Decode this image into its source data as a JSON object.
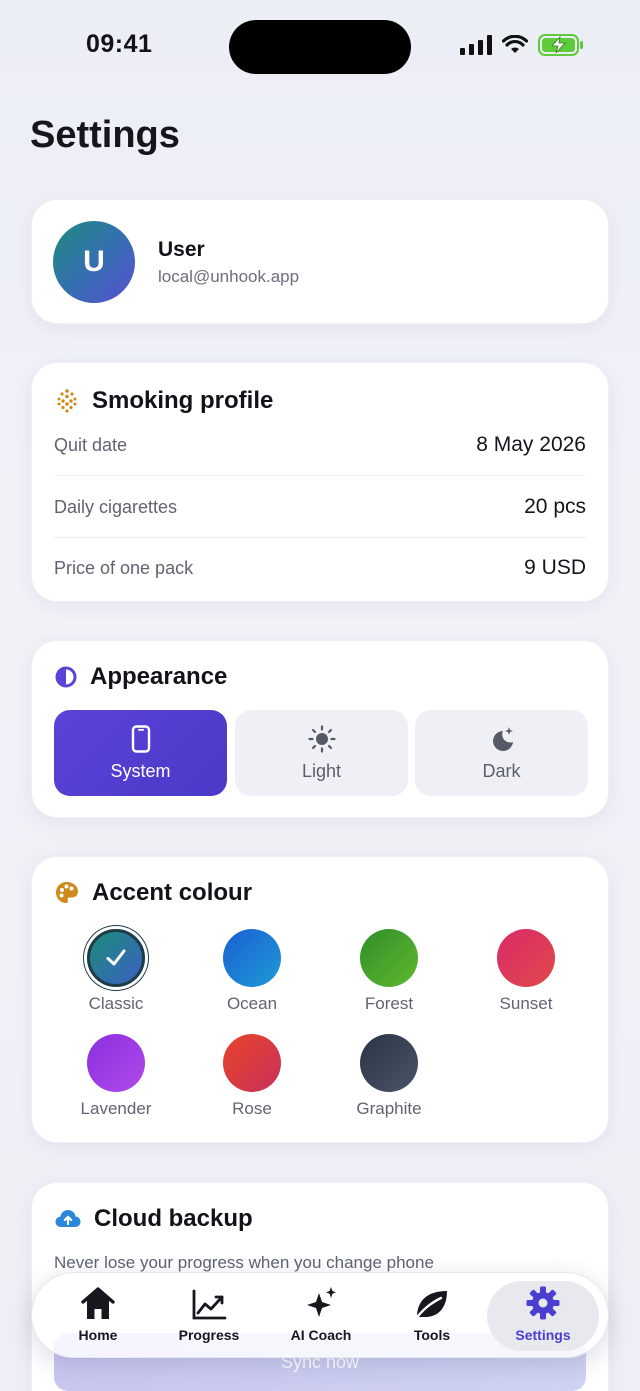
{
  "status_bar": {
    "time": "09:41"
  },
  "page": {
    "title": "Settings"
  },
  "profile": {
    "initial": "U",
    "name": "User",
    "email": "local@unhook.app"
  },
  "smoking_profile": {
    "title": "Smoking profile",
    "rows": [
      {
        "label": "Quit date",
        "value": "8 May 2026"
      },
      {
        "label": "Daily cigarettes",
        "value": "20 pcs"
      },
      {
        "label": "Price of one pack",
        "value": "9 USD"
      }
    ]
  },
  "appearance": {
    "title": "Appearance",
    "options": [
      {
        "label": "System",
        "icon": "phone-icon",
        "selected": true
      },
      {
        "label": "Light",
        "icon": "sun-icon",
        "selected": false
      },
      {
        "label": "Dark",
        "icon": "moon-icon",
        "selected": false
      }
    ]
  },
  "accent": {
    "title": "Accent colour",
    "selected": "Classic",
    "swatches": [
      {
        "name": "Classic",
        "color_from": "#1c8c78",
        "color_to": "#3b5fc4"
      },
      {
        "name": "Ocean",
        "color_from": "#1a5fd0",
        "color_to": "#1e9ad8"
      },
      {
        "name": "Forest",
        "color_from": "#2f8f2a",
        "color_to": "#5fb82e"
      },
      {
        "name": "Sunset",
        "color_from": "#d92a6a",
        "color_to": "#e04a4a"
      },
      {
        "name": "Lavender",
        "color_from": "#8a2fe0",
        "color_to": "#b04ae8"
      },
      {
        "name": "Rose",
        "color_from": "#e8442a",
        "color_to": "#c8305a"
      },
      {
        "name": "Graphite",
        "color_from": "#2c3446",
        "color_to": "#4a5468"
      }
    ]
  },
  "cloud_backup": {
    "title": "Cloud backup",
    "description": "Never lose your progress when you change phone",
    "sync_label": "Sync now"
  },
  "tabbar": {
    "tabs": [
      {
        "label": "Home",
        "icon": "home-icon",
        "active": false
      },
      {
        "label": "Progress",
        "icon": "chart-trend-icon",
        "active": false
      },
      {
        "label": "AI Coach",
        "icon": "sparkles-icon",
        "active": false
      },
      {
        "label": "Tools",
        "icon": "leaf-icon",
        "active": false
      },
      {
        "label": "Settings",
        "icon": "gear-icon",
        "active": true
      }
    ]
  },
  "colors": {
    "accent": "#4a3ed0",
    "text": "#14161c",
    "muted": "#5f6470"
  }
}
